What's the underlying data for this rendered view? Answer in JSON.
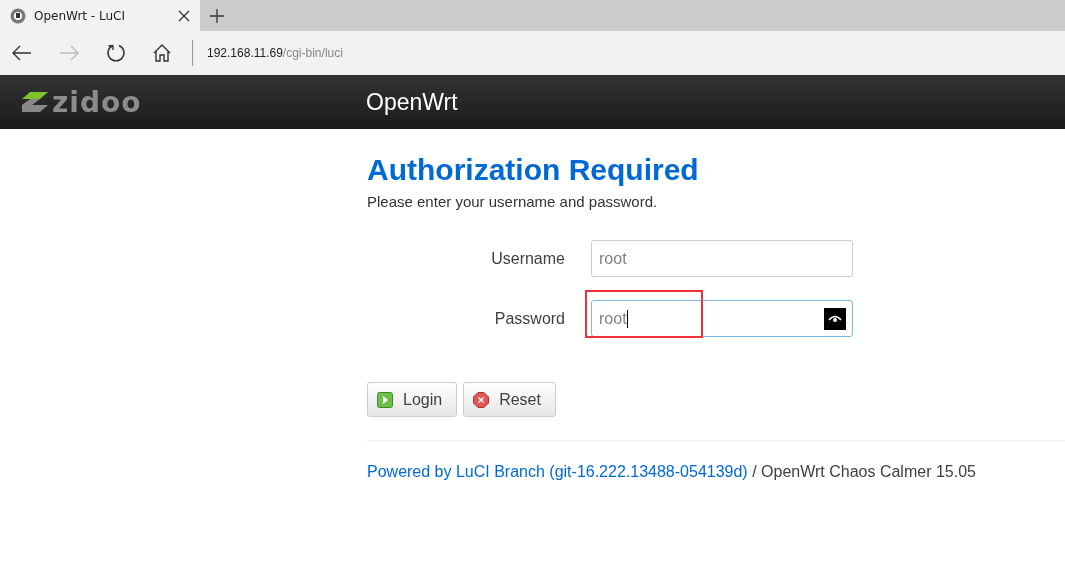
{
  "browser": {
    "tab": {
      "title": "OpenWrt - LuCI",
      "selected": true
    },
    "address": {
      "host": "192.168.11.69",
      "path": "/cgi-bin/luci"
    }
  },
  "header": {
    "logo": "zidoo",
    "title": "OpenWrt"
  },
  "page": {
    "heading": "Authorization Required",
    "intro": "Please enter your username and password."
  },
  "fields": [
    {
      "label": "Username",
      "value": "root",
      "kind": "text",
      "highlighted": false
    },
    {
      "label": "Password",
      "value": "root",
      "kind": "password",
      "highlighted": true
    }
  ],
  "buttons": [
    {
      "label": "Login",
      "kind": "login"
    },
    {
      "label": "Reset",
      "kind": "reset"
    }
  ],
  "footer": {
    "link": "Powered by LuCI Branch (git-16.222.13488-054139d)",
    "text": " / OpenWrt Chaos Calmer 15.05"
  }
}
